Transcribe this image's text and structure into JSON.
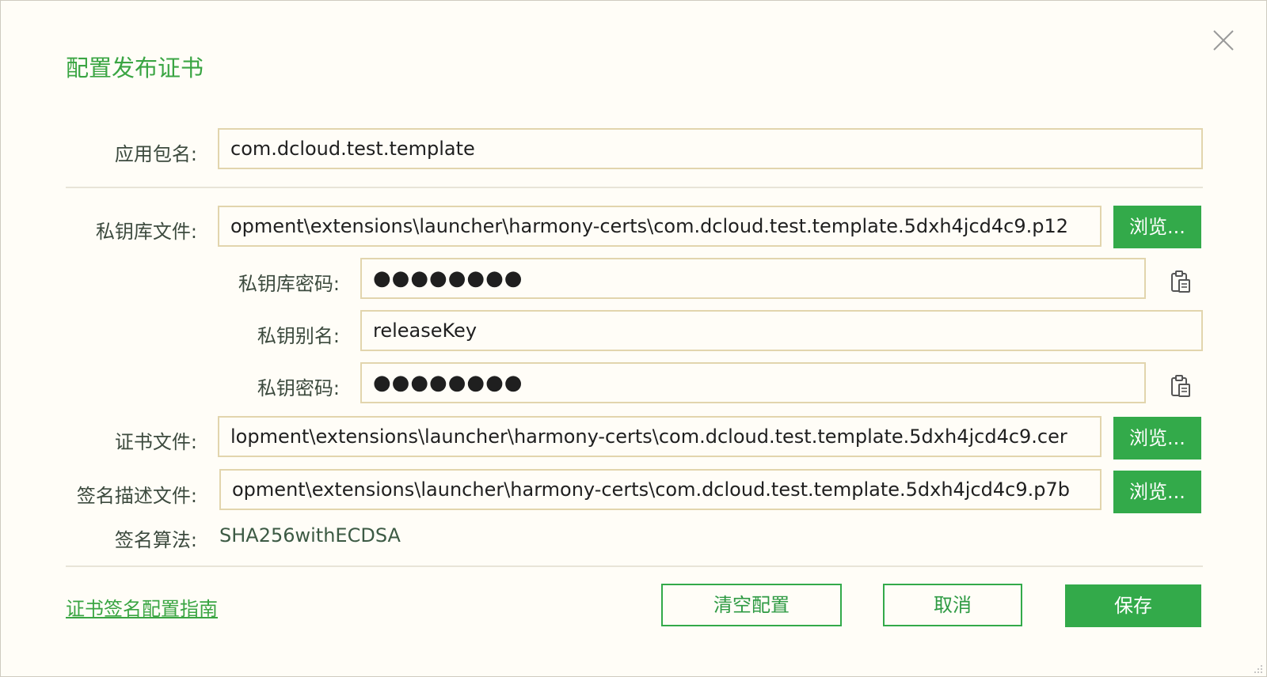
{
  "dialog": {
    "title": "配置发布证书",
    "close_icon": "close-icon"
  },
  "form": {
    "package_name": {
      "label": "应用包名:",
      "value": "com.dcloud.test.template"
    },
    "keystore_file": {
      "label": "私钥库文件:",
      "value": "opment\\extensions\\launcher\\harmony-certs\\com.dcloud.test.template.5dxh4jcd4c9.p12",
      "browse_label": "浏览..."
    },
    "keystore_password": {
      "label": "私钥库密码:",
      "value": "●●●●●●●●",
      "copy_icon": "clipboard-icon"
    },
    "key_alias": {
      "label": "私钥别名:",
      "value": "releaseKey"
    },
    "key_password": {
      "label": "私钥密码:",
      "value": "●●●●●●●●",
      "copy_icon": "clipboard-icon"
    },
    "cert_file": {
      "label": "证书文件:",
      "value": "lopment\\extensions\\launcher\\harmony-certs\\com.dcloud.test.template.5dxh4jcd4c9.cer",
      "browse_label": "浏览..."
    },
    "profile_file": {
      "label": "签名描述文件:",
      "value": "opment\\extensions\\launcher\\harmony-certs\\com.dcloud.test.template.5dxh4jcd4c9.p7b",
      "browse_label": "浏览..."
    },
    "sign_algorithm": {
      "label": "签名算法:",
      "value": "SHA256withECDSA"
    }
  },
  "footer": {
    "guide_link": "证书签名配置指南",
    "clear_label": "清空配置",
    "cancel_label": "取消",
    "save_label": "保存"
  },
  "colors": {
    "accent": "#33aa4a",
    "title": "#3aa543",
    "field_border": "#e2d5ad",
    "background": "#fffdf7"
  }
}
